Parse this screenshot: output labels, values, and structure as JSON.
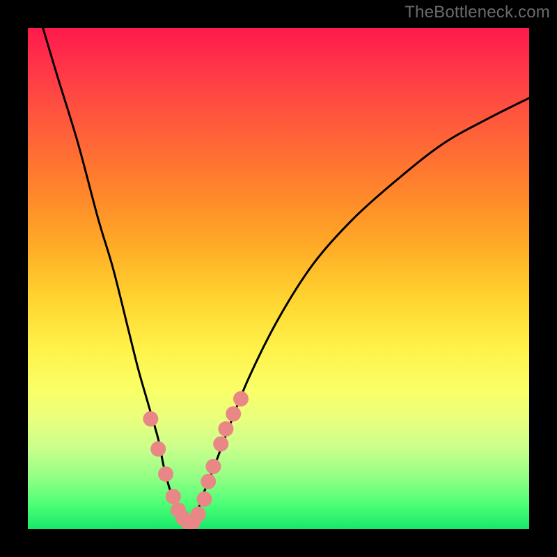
{
  "watermark": "TheBottleneck.com",
  "chart_data": {
    "type": "line",
    "title": "",
    "xlabel": "",
    "ylabel": "",
    "xlim": [
      0,
      100
    ],
    "ylim": [
      0,
      100
    ],
    "series": [
      {
        "name": "left-branch",
        "x": [
          3,
          6,
          10,
          14,
          17,
          20,
          22,
          24,
          26,
          27,
          28,
          29,
          30,
          31,
          32
        ],
        "y": [
          100,
          90,
          77,
          62,
          52,
          40,
          32,
          25,
          18,
          13,
          9,
          6,
          3.5,
          2,
          1
        ]
      },
      {
        "name": "right-branch",
        "x": [
          32,
          33,
          34,
          35,
          37,
          40,
          44,
          50,
          57,
          65,
          74,
          83,
          92,
          100
        ],
        "y": [
          1,
          2,
          4,
          7,
          12,
          20,
          30,
          42,
          53,
          62,
          70,
          77,
          82,
          86
        ]
      }
    ],
    "scatter": {
      "name": "data-points",
      "color": "#e98787",
      "radius_px": 11,
      "x": [
        24.5,
        26.0,
        27.5,
        29.0,
        30.0,
        31.0,
        32.0,
        33.0,
        34.0,
        35.2,
        36.0,
        37.0,
        38.5,
        39.5,
        41.0,
        42.5
      ],
      "y": [
        22.0,
        16.0,
        11.0,
        6.5,
        3.8,
        2.2,
        1.3,
        1.5,
        3.0,
        6.0,
        9.5,
        12.5,
        17.0,
        20.0,
        23.0,
        26.0
      ]
    },
    "gradient_stops": [
      {
        "pos": 0,
        "color": "#ff1a4d"
      },
      {
        "pos": 50,
        "color": "#ffe040"
      },
      {
        "pos": 100,
        "color": "#18e86a"
      }
    ]
  }
}
